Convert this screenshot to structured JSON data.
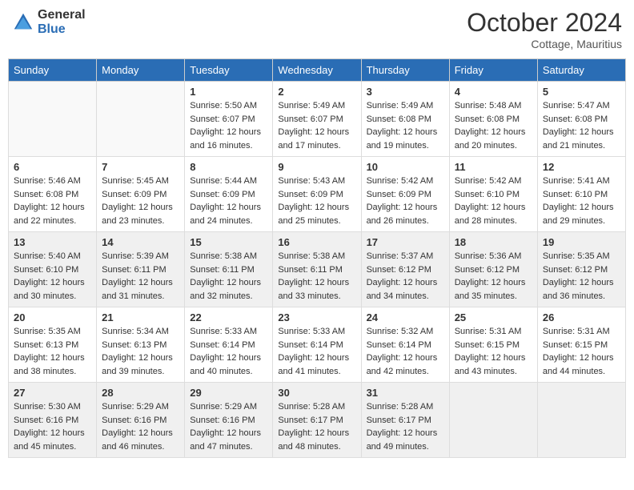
{
  "header": {
    "logo": {
      "general": "General",
      "blue": "Blue"
    },
    "title": "October 2024",
    "location": "Cottage, Mauritius"
  },
  "days_of_week": [
    "Sunday",
    "Monday",
    "Tuesday",
    "Wednesday",
    "Thursday",
    "Friday",
    "Saturday"
  ],
  "weeks": [
    {
      "shaded": false,
      "days": [
        {
          "date": "",
          "empty": true
        },
        {
          "date": "",
          "empty": true
        },
        {
          "date": "1",
          "sunrise": "5:50 AM",
          "sunset": "6:07 PM",
          "daylight": "12 hours and 16 minutes."
        },
        {
          "date": "2",
          "sunrise": "5:49 AM",
          "sunset": "6:07 PM",
          "daylight": "12 hours and 17 minutes."
        },
        {
          "date": "3",
          "sunrise": "5:49 AM",
          "sunset": "6:08 PM",
          "daylight": "12 hours and 19 minutes."
        },
        {
          "date": "4",
          "sunrise": "5:48 AM",
          "sunset": "6:08 PM",
          "daylight": "12 hours and 20 minutes."
        },
        {
          "date": "5",
          "sunrise": "5:47 AM",
          "sunset": "6:08 PM",
          "daylight": "12 hours and 21 minutes."
        }
      ]
    },
    {
      "shaded": false,
      "days": [
        {
          "date": "6",
          "sunrise": "5:46 AM",
          "sunset": "6:08 PM",
          "daylight": "12 hours and 22 minutes."
        },
        {
          "date": "7",
          "sunrise": "5:45 AM",
          "sunset": "6:09 PM",
          "daylight": "12 hours and 23 minutes."
        },
        {
          "date": "8",
          "sunrise": "5:44 AM",
          "sunset": "6:09 PM",
          "daylight": "12 hours and 24 minutes."
        },
        {
          "date": "9",
          "sunrise": "5:43 AM",
          "sunset": "6:09 PM",
          "daylight": "12 hours and 25 minutes."
        },
        {
          "date": "10",
          "sunrise": "5:42 AM",
          "sunset": "6:09 PM",
          "daylight": "12 hours and 26 minutes."
        },
        {
          "date": "11",
          "sunrise": "5:42 AM",
          "sunset": "6:10 PM",
          "daylight": "12 hours and 28 minutes."
        },
        {
          "date": "12",
          "sunrise": "5:41 AM",
          "sunset": "6:10 PM",
          "daylight": "12 hours and 29 minutes."
        }
      ]
    },
    {
      "shaded": true,
      "days": [
        {
          "date": "13",
          "sunrise": "5:40 AM",
          "sunset": "6:10 PM",
          "daylight": "12 hours and 30 minutes."
        },
        {
          "date": "14",
          "sunrise": "5:39 AM",
          "sunset": "6:11 PM",
          "daylight": "12 hours and 31 minutes."
        },
        {
          "date": "15",
          "sunrise": "5:38 AM",
          "sunset": "6:11 PM",
          "daylight": "12 hours and 32 minutes."
        },
        {
          "date": "16",
          "sunrise": "5:38 AM",
          "sunset": "6:11 PM",
          "daylight": "12 hours and 33 minutes."
        },
        {
          "date": "17",
          "sunrise": "5:37 AM",
          "sunset": "6:12 PM",
          "daylight": "12 hours and 34 minutes."
        },
        {
          "date": "18",
          "sunrise": "5:36 AM",
          "sunset": "6:12 PM",
          "daylight": "12 hours and 35 minutes."
        },
        {
          "date": "19",
          "sunrise": "5:35 AM",
          "sunset": "6:12 PM",
          "daylight": "12 hours and 36 minutes."
        }
      ]
    },
    {
      "shaded": false,
      "days": [
        {
          "date": "20",
          "sunrise": "5:35 AM",
          "sunset": "6:13 PM",
          "daylight": "12 hours and 38 minutes."
        },
        {
          "date": "21",
          "sunrise": "5:34 AM",
          "sunset": "6:13 PM",
          "daylight": "12 hours and 39 minutes."
        },
        {
          "date": "22",
          "sunrise": "5:33 AM",
          "sunset": "6:14 PM",
          "daylight": "12 hours and 40 minutes."
        },
        {
          "date": "23",
          "sunrise": "5:33 AM",
          "sunset": "6:14 PM",
          "daylight": "12 hours and 41 minutes."
        },
        {
          "date": "24",
          "sunrise": "5:32 AM",
          "sunset": "6:14 PM",
          "daylight": "12 hours and 42 minutes."
        },
        {
          "date": "25",
          "sunrise": "5:31 AM",
          "sunset": "6:15 PM",
          "daylight": "12 hours and 43 minutes."
        },
        {
          "date": "26",
          "sunrise": "5:31 AM",
          "sunset": "6:15 PM",
          "daylight": "12 hours and 44 minutes."
        }
      ]
    },
    {
      "shaded": true,
      "days": [
        {
          "date": "27",
          "sunrise": "5:30 AM",
          "sunset": "6:16 PM",
          "daylight": "12 hours and 45 minutes."
        },
        {
          "date": "28",
          "sunrise": "5:29 AM",
          "sunset": "6:16 PM",
          "daylight": "12 hours and 46 minutes."
        },
        {
          "date": "29",
          "sunrise": "5:29 AM",
          "sunset": "6:16 PM",
          "daylight": "12 hours and 47 minutes."
        },
        {
          "date": "30",
          "sunrise": "5:28 AM",
          "sunset": "6:17 PM",
          "daylight": "12 hours and 48 minutes."
        },
        {
          "date": "31",
          "sunrise": "5:28 AM",
          "sunset": "6:17 PM",
          "daylight": "12 hours and 49 minutes."
        },
        {
          "date": "",
          "empty": true
        },
        {
          "date": "",
          "empty": true
        }
      ]
    }
  ]
}
